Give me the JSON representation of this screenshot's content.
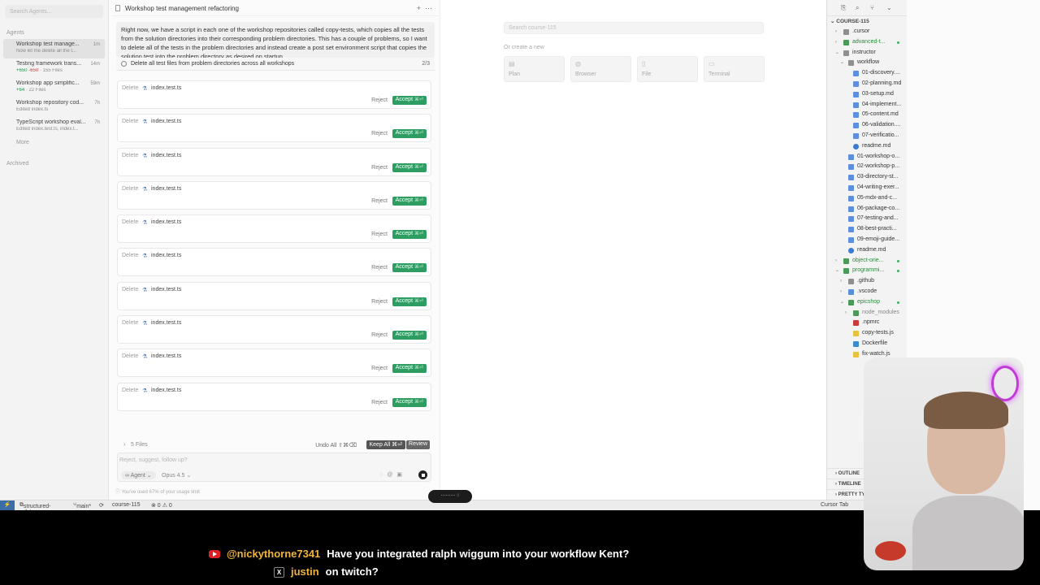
{
  "sidebar": {
    "search_placeholder": "Search Agents...",
    "agents_label": "Agents",
    "items": [
      {
        "title": "Workshop test manage...",
        "sub": "Now let me delete all the t...",
        "time": "1m"
      },
      {
        "title": "Testing framework trans...",
        "added": "+650",
        "removed": "-650",
        "files": "155 Files",
        "time": "14m"
      },
      {
        "title": "Workshop app simplific...",
        "added": "+64",
        "files": "22 Files",
        "time": "59m"
      },
      {
        "title": "Workshop repository cod...",
        "sub": "Edited index.ts",
        "time": "7h"
      },
      {
        "title": "TypeScript workshop eval...",
        "sub": "Edited index.test.ts, index.t...",
        "time": "7h"
      }
    ],
    "more_label": "More",
    "archived_label": "Archived"
  },
  "chat": {
    "title": "Workshop test management refactoring",
    "message": "Right now, we have a script in each one of the workshop repositories called copy-tests, which copies all the tests from the solution directories into their corresponding problem directories. This has a couple of problems, so I want to delete all of the tests in the problem directories and instead create a post set environment script that copies the solution test into the problem directory as desired on startup",
    "todo": "Delete all test files from problem directories across all workshops",
    "todo_count": "2/3",
    "cards": [
      {
        "verb": "Delete",
        "file": "index.test.ts",
        "reject": "Reject",
        "accept": "Accept",
        "kbd": "⌘⏎"
      },
      {
        "verb": "Delete",
        "file": "index.test.ts",
        "reject": "Reject",
        "accept": "Accept",
        "kbd": "⌘⏎"
      },
      {
        "verb": "Delete",
        "file": "index.test.ts",
        "reject": "Reject",
        "accept": "Accept",
        "kbd": "⌘⏎"
      },
      {
        "verb": "Delete",
        "file": "index.test.ts",
        "reject": "Reject",
        "accept": "Accept",
        "kbd": "⌘⏎"
      },
      {
        "verb": "Delete",
        "file": "index.test.ts",
        "reject": "Reject",
        "accept": "Accept",
        "kbd": "⌘⏎"
      },
      {
        "verb": "Delete",
        "file": "index.test.ts",
        "reject": "Reject",
        "accept": "Accept",
        "kbd": "⌘⏎"
      },
      {
        "verb": "Delete",
        "file": "index.test.ts",
        "reject": "Reject",
        "accept": "Accept",
        "kbd": "⌘⏎"
      },
      {
        "verb": "Delete",
        "file": "index.test.ts",
        "reject": "Reject",
        "accept": "Accept",
        "kbd": "⌘⏎"
      },
      {
        "verb": "Delete",
        "file": "index.test.ts",
        "reject": "Reject",
        "accept": "Accept",
        "kbd": "⌘⏎"
      },
      {
        "verb": "Delete",
        "file": "index.test.ts",
        "reject": "Reject",
        "accept": "Accept",
        "kbd": "⌘⏎"
      }
    ],
    "files_label": "5 Files",
    "undo_all": "Undo All ⇧⌘⌫",
    "keep_all": "Keep All ⌘⏎",
    "review": "Review",
    "composer_placeholder": "Reject, suggest, follow up?",
    "agent_mode": "Agent",
    "model": "Opus 4.5",
    "usage_note": "You've used 67% of your usage limit"
  },
  "middle": {
    "search_placeholder": "Search course-115",
    "or_create": "Or create a new",
    "tiles": [
      "Plan",
      "Browser",
      "File",
      "Terminal"
    ]
  },
  "explorer": {
    "root": "COURSE-115",
    "tree": [
      {
        "label": ".cursor",
        "depth": 0,
        "kind": "folder",
        "open": false
      },
      {
        "label": "advanced-t...",
        "depth": 0,
        "kind": "folder-g",
        "open": false,
        "dot": true,
        "green": true
      },
      {
        "label": "instructor",
        "depth": 0,
        "kind": "folder",
        "open": true
      },
      {
        "label": "workflow",
        "depth": 1,
        "kind": "folder",
        "open": true
      },
      {
        "label": "01-discovery....",
        "depth": 2,
        "kind": "md"
      },
      {
        "label": "02-planning.md",
        "depth": 2,
        "kind": "md"
      },
      {
        "label": "03-setup.md",
        "depth": 2,
        "kind": "md"
      },
      {
        "label": "04-implement...",
        "depth": 2,
        "kind": "md"
      },
      {
        "label": "05-content.md",
        "depth": 2,
        "kind": "md"
      },
      {
        "label": "06-validation....",
        "depth": 2,
        "kind": "md"
      },
      {
        "label": "07-verificatio...",
        "depth": 2,
        "kind": "md"
      },
      {
        "label": "readme.md",
        "depth": 2,
        "kind": "info"
      },
      {
        "label": "01-workshop-o...",
        "depth": 1,
        "kind": "md"
      },
      {
        "label": "02-workshop-p...",
        "depth": 1,
        "kind": "md"
      },
      {
        "label": "03-directory-st...",
        "depth": 1,
        "kind": "md"
      },
      {
        "label": "04-writing-exer...",
        "depth": 1,
        "kind": "md"
      },
      {
        "label": "05-mdx-and-c...",
        "depth": 1,
        "kind": "md"
      },
      {
        "label": "06-package-co...",
        "depth": 1,
        "kind": "md"
      },
      {
        "label": "07-testing-and...",
        "depth": 1,
        "kind": "md"
      },
      {
        "label": "08-best-practi...",
        "depth": 1,
        "kind": "md"
      },
      {
        "label": "09-emoji-guide...",
        "depth": 1,
        "kind": "md"
      },
      {
        "label": "readme.md",
        "depth": 1,
        "kind": "info"
      },
      {
        "label": "object-orie...",
        "depth": 0,
        "kind": "folder-g",
        "open": false,
        "dot": true,
        "green": true
      },
      {
        "label": "programmi...",
        "depth": 0,
        "kind": "folder-g",
        "open": true,
        "dot": true,
        "green": true
      },
      {
        "label": ".github",
        "depth": 1,
        "kind": "folder",
        "open": false
      },
      {
        "label": ".vscode",
        "depth": 1,
        "kind": "folder-b",
        "open": false
      },
      {
        "label": "epicshop",
        "depth": 1,
        "kind": "folder-g",
        "open": true,
        "dot": true,
        "green": true
      },
      {
        "label": "node_modules",
        "depth": 2,
        "kind": "folder-g",
        "open": false,
        "muted": true
      },
      {
        "label": ".npmrc",
        "depth": 2,
        "kind": "npm"
      },
      {
        "label": "copy-tests.js",
        "depth": 2,
        "kind": "js"
      },
      {
        "label": "Dockerfile",
        "depth": 2,
        "kind": "docker"
      },
      {
        "label": "fix-watch.js",
        "depth": 2,
        "kind": "js"
      }
    ],
    "outline": "OUTLINE",
    "timeline": "TIMELINE",
    "pretty": "PRETTY TY..."
  },
  "status": {
    "vs": "⚡",
    "branch_repo": "structured-data",
    "branch": "main*",
    "course": "course-115",
    "problems": "⊗ 0 ⚠ 0",
    "cursor_tab": "Cursor Tab"
  },
  "overlay": {
    "yt_user": "@nickythorne7341",
    "yt_msg": "Have you integrated ralph wiggum into your workflow Kent?",
    "x_user": "justin",
    "x_msg": "on twitch?"
  },
  "colors": {
    "accept": "#2d9d62",
    "added": "#1a9a4a",
    "removed": "#c83a3a",
    "username": "#f0b43a"
  }
}
